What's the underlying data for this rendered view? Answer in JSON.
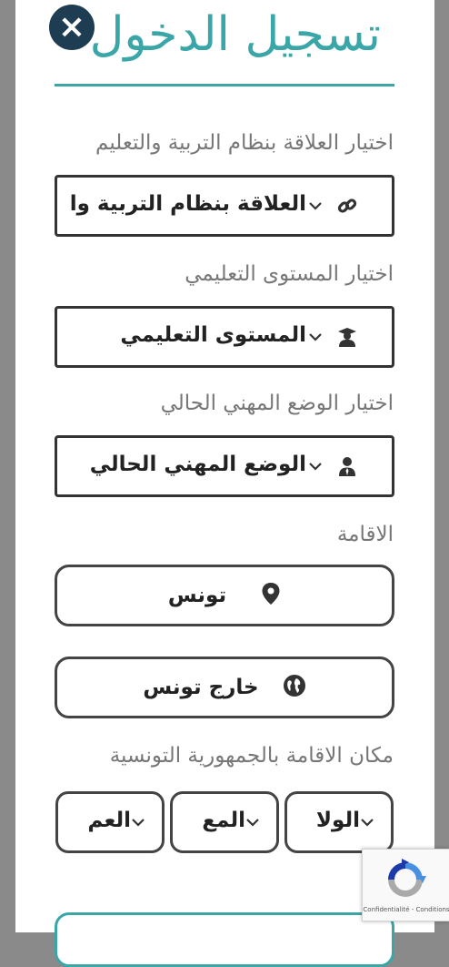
{
  "title": "تسجيل الدخول",
  "close_label": "×",
  "fields": {
    "relation": {
      "label": "اختيار العلاقة بنظام التربية والتعليم",
      "value": "العلاقة بنظام التربية والا",
      "icon": "link-icon"
    },
    "level": {
      "label": "اختيار المستوى التعليمي",
      "value": "المستوى التعليمي",
      "icon": "graduate-icon"
    },
    "job": {
      "label": "اختيار الوضع المهني الحالي",
      "value": "الوضع المهني الحالي",
      "icon": "user-tie-icon"
    }
  },
  "residence": {
    "label": "الاقامة",
    "tunisia": {
      "label": "تونس",
      "icon": "map-pin-icon"
    },
    "abroad": {
      "label": "خارج تونس",
      "icon": "globe-icon"
    }
  },
  "location": {
    "label": "مكان الاقامة بالجمهورية التونسية",
    "state": "الولا",
    "delegation": "المع",
    "sector": "العم"
  },
  "recaptcha": {
    "links": "Confidentialité - Conditions"
  },
  "colors": {
    "accent": "#3aa6a8",
    "close_bg": "#1f3d52"
  }
}
